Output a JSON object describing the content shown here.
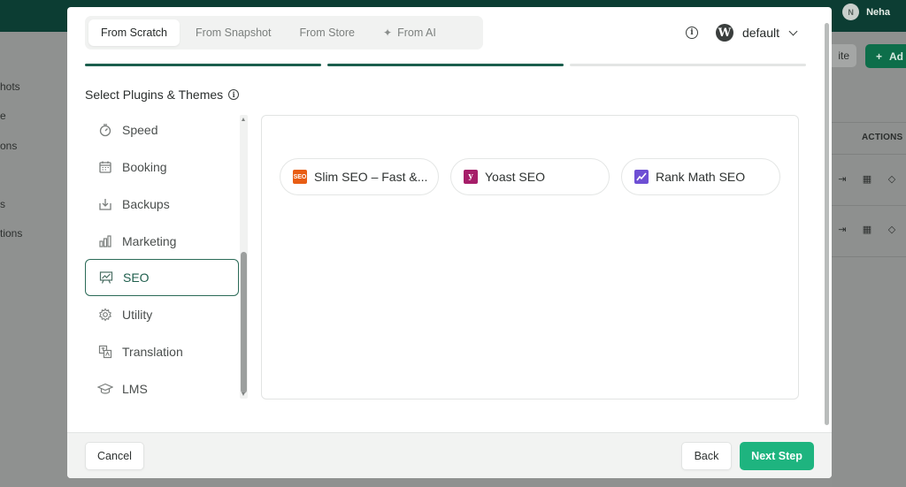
{
  "background": {
    "user_initial": "N",
    "user_name": "Neha",
    "sidebar_fragments": [
      "hots",
      "e",
      "ons",
      "s",
      "tions"
    ],
    "lite_button": "ite",
    "add_button": "Ad",
    "actions_header": "ACTIONS"
  },
  "modal": {
    "tabs": [
      {
        "label": "From Scratch",
        "active": true
      },
      {
        "label": "From Snapshot",
        "active": false
      },
      {
        "label": "From Store",
        "active": false
      },
      {
        "label": "From AI",
        "active": false,
        "icon": "sparkle-icon"
      }
    ],
    "site_selector": {
      "icon": "wordpress-icon",
      "name": "default"
    },
    "progress_steps": [
      "done",
      "done",
      "pending"
    ],
    "section_title": "Select Plugins & Themes",
    "categories": [
      {
        "label": "Speed",
        "icon": "speed-icon"
      },
      {
        "label": "Booking",
        "icon": "calendar-icon"
      },
      {
        "label": "Backups",
        "icon": "backup-icon"
      },
      {
        "label": "Marketing",
        "icon": "bar-chart-icon"
      },
      {
        "label": "SEO",
        "icon": "seo-chart-icon",
        "active": true
      },
      {
        "label": "Utility",
        "icon": "gear-icon"
      },
      {
        "label": "Translation",
        "icon": "translate-icon"
      },
      {
        "label": "LMS",
        "icon": "graduation-cap-icon"
      }
    ],
    "plugins": [
      {
        "label": "Slim SEO – Fast &...",
        "logo": "slim-seo-logo",
        "logo_text": "SEO"
      },
      {
        "label": "Yoast SEO",
        "logo": "yoast-logo",
        "logo_text": "y"
      },
      {
        "label": "Rank Math SEO",
        "logo": "rank-math-logo",
        "logo_text": ""
      }
    ],
    "footer": {
      "cancel": "Cancel",
      "back": "Back",
      "next": "Next Step"
    }
  },
  "colors": {
    "accent": "#1eb47f",
    "dark_green": "#1b5e4d",
    "topbar": "#0c3d33"
  }
}
